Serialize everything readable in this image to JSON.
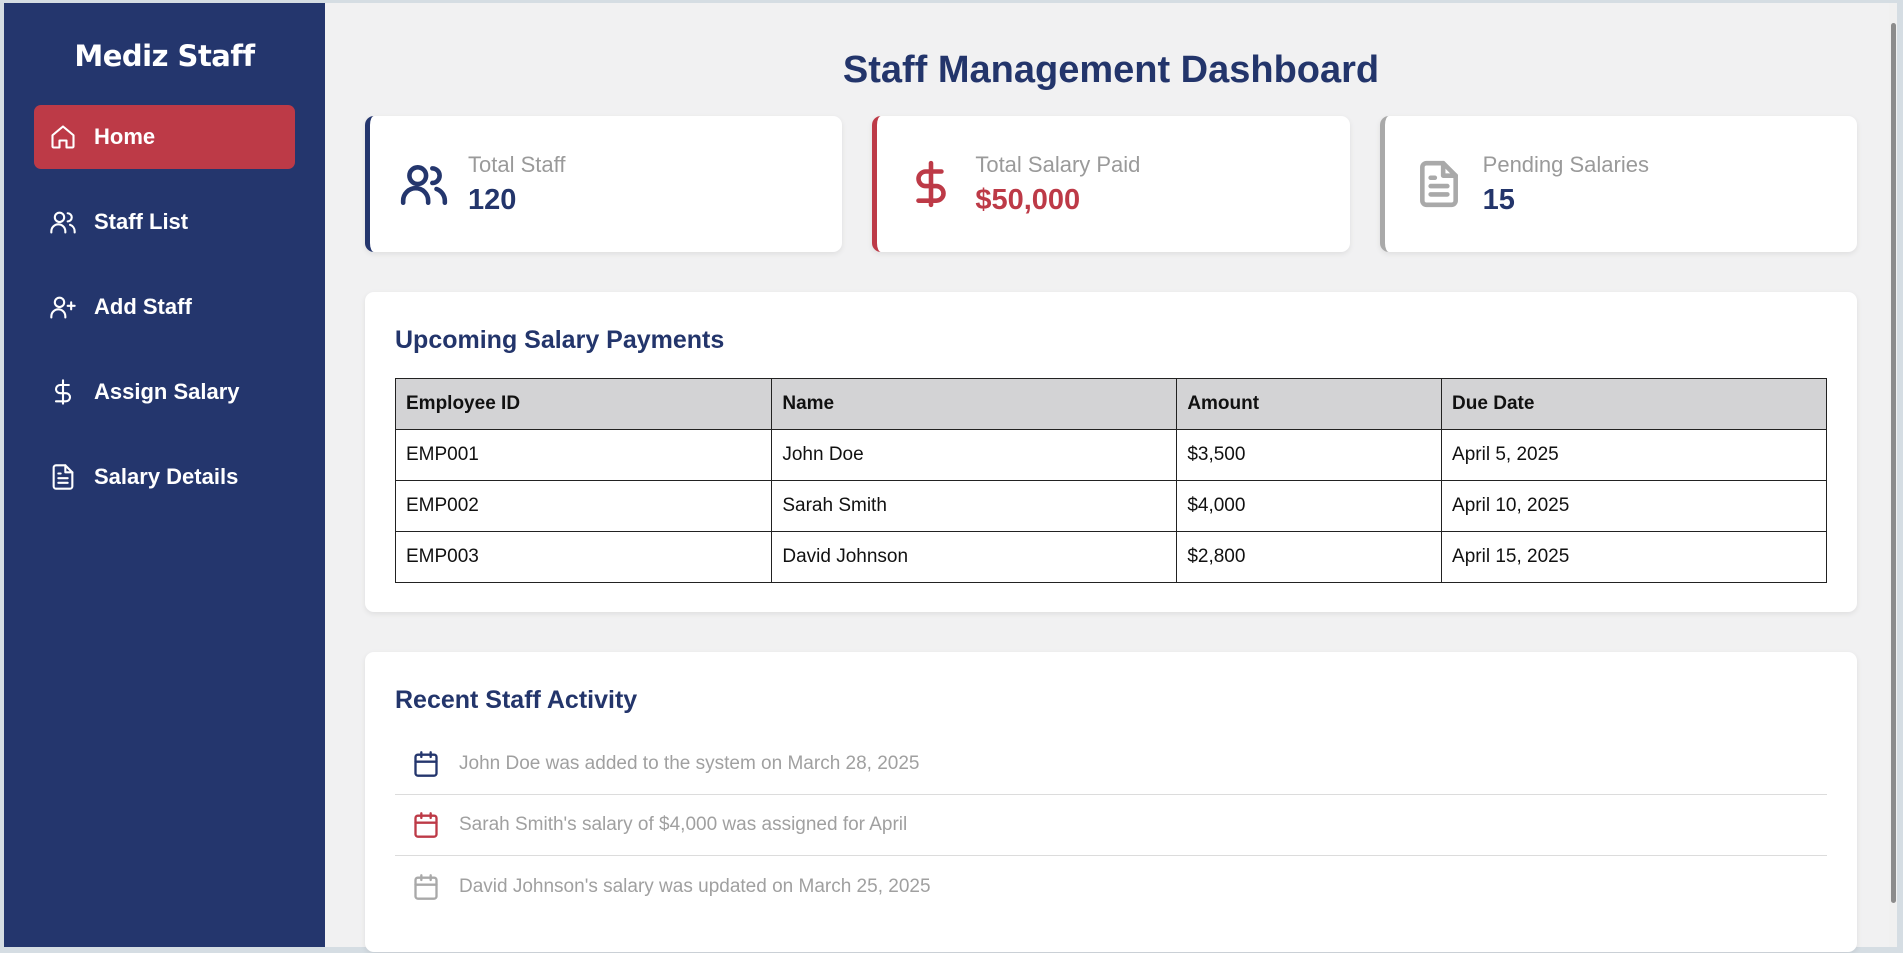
{
  "brand": "Mediz Staff",
  "nav": [
    {
      "label": "Home",
      "icon": "home-icon",
      "active": true
    },
    {
      "label": "Staff List",
      "icon": "users-icon"
    },
    {
      "label": "Add Staff",
      "icon": "user-plus-icon"
    },
    {
      "label": "Assign Salary",
      "icon": "dollar-icon"
    },
    {
      "label": "Salary Details",
      "icon": "file-icon"
    }
  ],
  "page_title": "Staff Management Dashboard",
  "cards": [
    {
      "label": "Total Staff",
      "value": "120",
      "icon": "users-icon",
      "color": "#24366d"
    },
    {
      "label": "Total Salary Paid",
      "value": "$50,000",
      "icon": "dollar-icon",
      "color": "#bd3a47"
    },
    {
      "label": "Pending Salaries",
      "value": "15",
      "icon": "file-icon",
      "color": "#a9a9a9"
    }
  ],
  "upcoming": {
    "title": "Upcoming Salary Payments",
    "columns": [
      "Employee ID",
      "Name",
      "Amount",
      "Due Date"
    ],
    "rows": [
      [
        "EMP001",
        "John Doe",
        "$3,500",
        "April 5, 2025"
      ],
      [
        "EMP002",
        "Sarah Smith",
        "$4,000",
        "April 10, 2025"
      ],
      [
        "EMP003",
        "David Johnson",
        "$2,800",
        "April 15, 2025"
      ]
    ]
  },
  "activity": {
    "title": "Recent Staff Activity",
    "items": [
      {
        "text": "John Doe was added to the system on March 28, 2025",
        "icon": "calendar-icon",
        "color": "#24366d"
      },
      {
        "text": "Sarah Smith's salary of $4,000 was assigned for April",
        "icon": "calendar-icon",
        "color": "#bd3a47"
      },
      {
        "text": "David Johnson's salary was updated on March 25, 2025",
        "icon": "calendar-icon",
        "color": "#a9a9a9"
      }
    ]
  },
  "colors": {
    "sidebar": "#24366d",
    "accent_red": "#bd3a47",
    "title_blue": "#23356b",
    "background": "#f1f1f2"
  }
}
